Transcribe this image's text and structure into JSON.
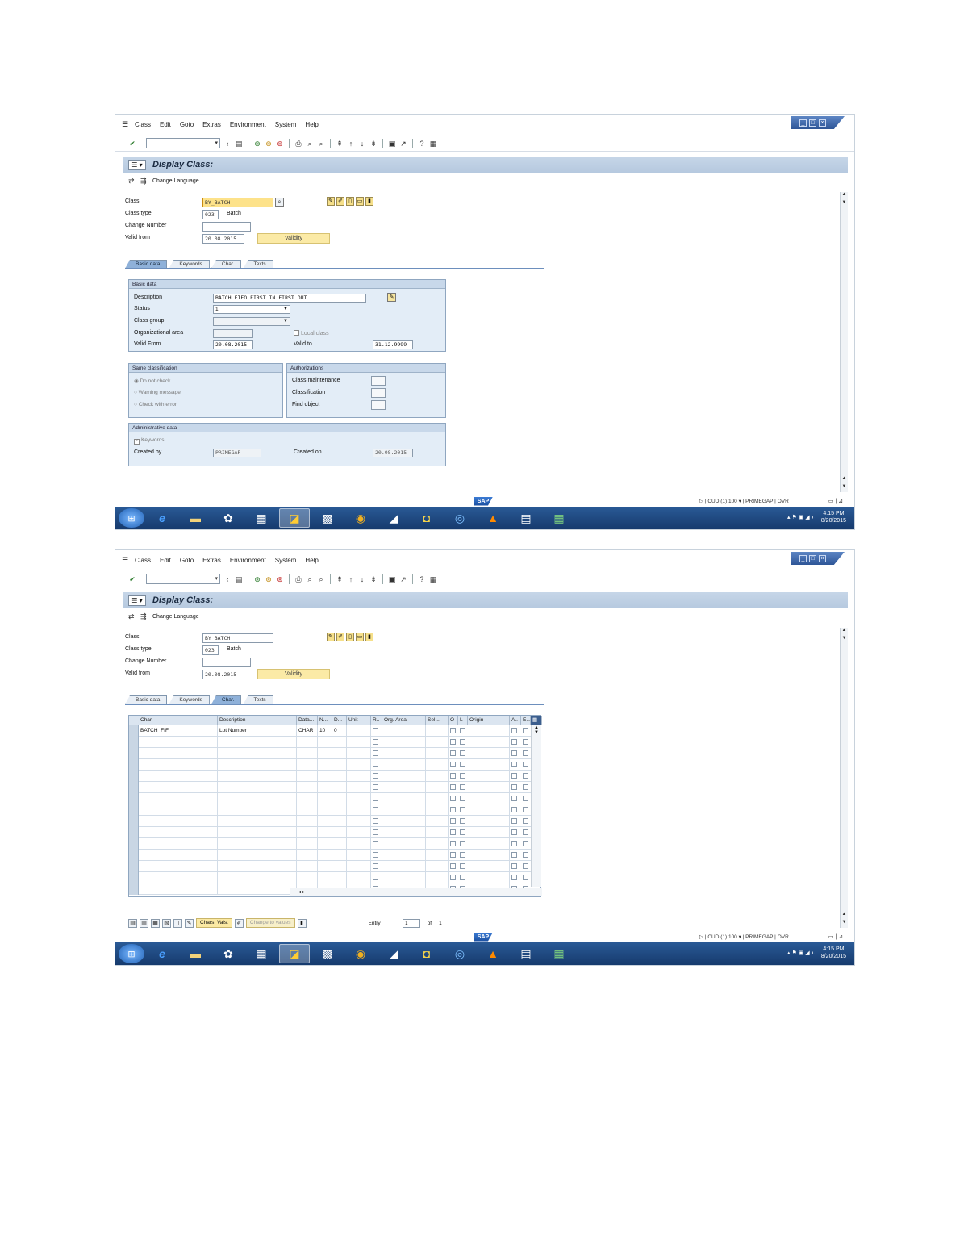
{
  "menu": [
    "Class",
    "Edit",
    "Goto",
    "Extras",
    "Environment",
    "System",
    "Help"
  ],
  "title": "Display Class:",
  "app_toolbar": {
    "change_language": "Change Language"
  },
  "header": {
    "class_label": "Class",
    "class_value": "BY_BATCH",
    "class_type_label": "Class type",
    "class_type_value": "023",
    "class_type_text": "Batch",
    "change_number_label": "Change Number",
    "change_number_value": "",
    "valid_from_label": "Valid from",
    "valid_from_value": "20.08.2015",
    "validity_button": "Validity"
  },
  "tabs": [
    "Basic data",
    "Keywords",
    "Char.",
    "Texts"
  ],
  "basic_data": {
    "group_title": "Basic data",
    "description_label": "Description",
    "description_value": "BATCH FIFO FIRST IN FIRST OUT",
    "status_label": "Status",
    "status_value": "1",
    "class_group_label": "Class group",
    "class_group_value": "",
    "org_area_label": "Organizational area",
    "org_area_value": "",
    "local_class_label": "Local class",
    "valid_from_label": "Valid From",
    "valid_from_value": "20.08.2015",
    "valid_to_label": "Valid to",
    "valid_to_value": "31.12.9999"
  },
  "same_classification": {
    "group_title": "Same classification",
    "options": [
      "Do not check",
      "Warning message",
      "Check with error"
    ]
  },
  "authorizations": {
    "group_title": "Authorizations",
    "items": [
      "Class maintenance",
      "Classification",
      "Find object"
    ]
  },
  "admin_data": {
    "group_title": "Administrative data",
    "keywords_label": "Keywords",
    "created_by_label": "Created by",
    "created_by_value": "PRIMEGAP",
    "created_on_label": "Created on",
    "created_on_value": "20.08.2015"
  },
  "char_table": {
    "columns": [
      "Char.",
      "Description",
      "Data...",
      "N...",
      "D...",
      "Unit",
      "R..",
      "Org. Area",
      "Sel ...",
      "O",
      "L",
      "Origin",
      "A..",
      "E..."
    ],
    "rows": [
      {
        "char": "BATCH_FIF",
        "description": "Lot Number",
        "data": "CHAR",
        "n": "10",
        "d": "0"
      }
    ],
    "bottom_buttons": {
      "chars_vals": "Chars. Vals.",
      "change_to_values": "Change to values"
    },
    "entry_label": "Entry",
    "entry_value": "1",
    "of_label": "of",
    "of_value": "1"
  },
  "status": {
    "system": "CUD (1) 100",
    "host": "PRIMEGAP",
    "mode": "OVR"
  },
  "clock": {
    "time": "4:15 PM",
    "date": "8/20/2015"
  }
}
